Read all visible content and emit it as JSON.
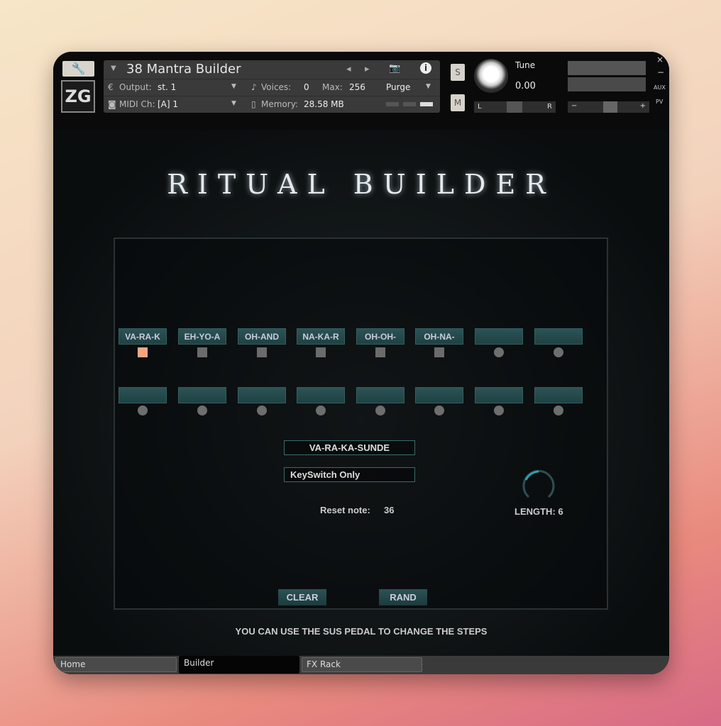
{
  "header": {
    "instrument_name": "38 Mantra Builder",
    "output_label": "Output:",
    "output_value": "st. 1",
    "midi_label": "MIDI Ch:",
    "midi_value": "[A] 1",
    "voices_label": "Voices:",
    "voices_value": "0",
    "max_label": "Max:",
    "max_value": "256",
    "memory_label": "Memory:",
    "memory_value": "28.58 MB",
    "purge_label": "Purge",
    "solo": "S",
    "mute": "M",
    "tune_label": "Tune",
    "tune_value": "0.00",
    "pan_left": "L",
    "pan_right": "R",
    "vol_minus": "−",
    "vol_plus": "+",
    "close": "×",
    "minimize": "−",
    "aux": "AUX",
    "pv": "PV",
    "logo": "ZG"
  },
  "main": {
    "title": "RITUAL BUILDER",
    "steps_row1": [
      "VA-RA-K",
      "EH-YO-A",
      "OH-AND",
      "NA-KA-R",
      "OH-OH-",
      "OH-NA-",
      "",
      ""
    ],
    "steps_row1_indicator": [
      "active",
      "square",
      "square",
      "square",
      "square",
      "square",
      "dot",
      "dot"
    ],
    "steps_row2": [
      "",
      "",
      "",
      "",
      "",
      "",
      "",
      ""
    ],
    "selected_mantra": "VA-RA-KA-SUNDE",
    "mode": "KeySwitch Only",
    "reset_label": "Reset note:",
    "reset_value": "36",
    "length_label": "LENGTH: 6",
    "length_fraction": 0.5,
    "clear": "CLEAR",
    "rand": "RAND",
    "hint": "YOU CAN USE THE SUS PEDAL TO CHANGE THE STEPS",
    "accent": "#2a8a92",
    "active_color": "#f2a783"
  },
  "tabs": [
    {
      "label": "Home"
    },
    {
      "label": "Builder",
      "active": true
    },
    {
      "label": "FX Rack"
    }
  ]
}
